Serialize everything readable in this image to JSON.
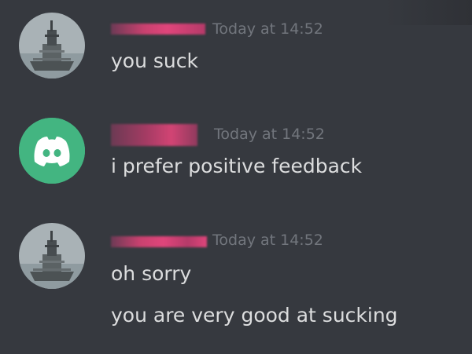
{
  "messages": [
    {
      "avatar": "ship-photo-avatar",
      "timestamp": "Today at 14:52",
      "lines": [
        "you suck"
      ]
    },
    {
      "avatar": "discord-logo-avatar",
      "timestamp": "Today at 14:52",
      "lines": [
        "i prefer positive feedback"
      ]
    },
    {
      "avatar": "ship-photo-avatar",
      "timestamp": "Today at 14:52",
      "lines": [
        "oh sorry",
        "you are very good at sucking"
      ]
    }
  ],
  "colors": {
    "background": "#36393f",
    "text": "#dcddde",
    "timestamp": "#72767d",
    "discord_green": "#43b581",
    "redaction_pink": "#e0457b"
  }
}
